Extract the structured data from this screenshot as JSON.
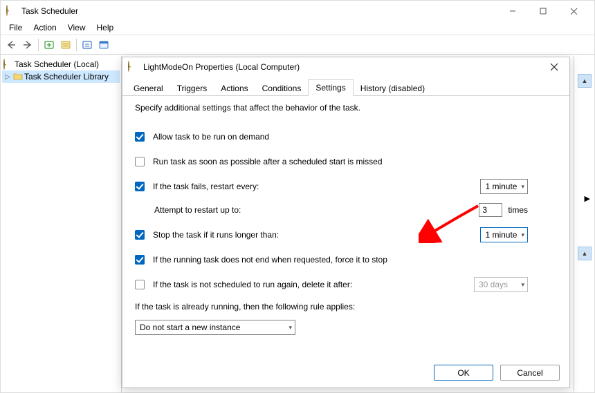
{
  "window": {
    "title": "Task Scheduler",
    "menus": [
      "File",
      "Action",
      "View",
      "Help"
    ]
  },
  "tree": {
    "root_label": "Task Scheduler (Local)",
    "library_label": "Task Scheduler Library"
  },
  "dialog": {
    "title": "LightModeOn Properties (Local Computer)",
    "tabs": [
      "General",
      "Triggers",
      "Actions",
      "Conditions",
      "Settings",
      "History (disabled)"
    ],
    "selected_tab": "Settings",
    "intro": "Specify additional settings that affect the behavior of the task.",
    "allow_on_demand": {
      "checked": true,
      "label": "Allow task to be run on demand"
    },
    "run_asap": {
      "checked": false,
      "label": "Run task as soon as possible after a scheduled start is missed"
    },
    "restart_every": {
      "checked": true,
      "label": "If the task fails, restart every:",
      "value": "1 minute"
    },
    "attempt_restart": {
      "label": "Attempt to restart up to:",
      "value": "3",
      "suffix": "times"
    },
    "stop_if_longer": {
      "checked": true,
      "label": "Stop the task if it runs longer than:",
      "value": "1 minute"
    },
    "force_stop": {
      "checked": true,
      "label": "If the running task does not end when requested, force it to stop"
    },
    "delete_after": {
      "checked": false,
      "label": "If the task is not scheduled to run again, delete it after:",
      "value": "30 days"
    },
    "rule_label": "If the task is already running, then the following rule applies:",
    "rule_value": "Do not start a new instance",
    "buttons": {
      "ok": "OK",
      "cancel": "Cancel"
    }
  }
}
